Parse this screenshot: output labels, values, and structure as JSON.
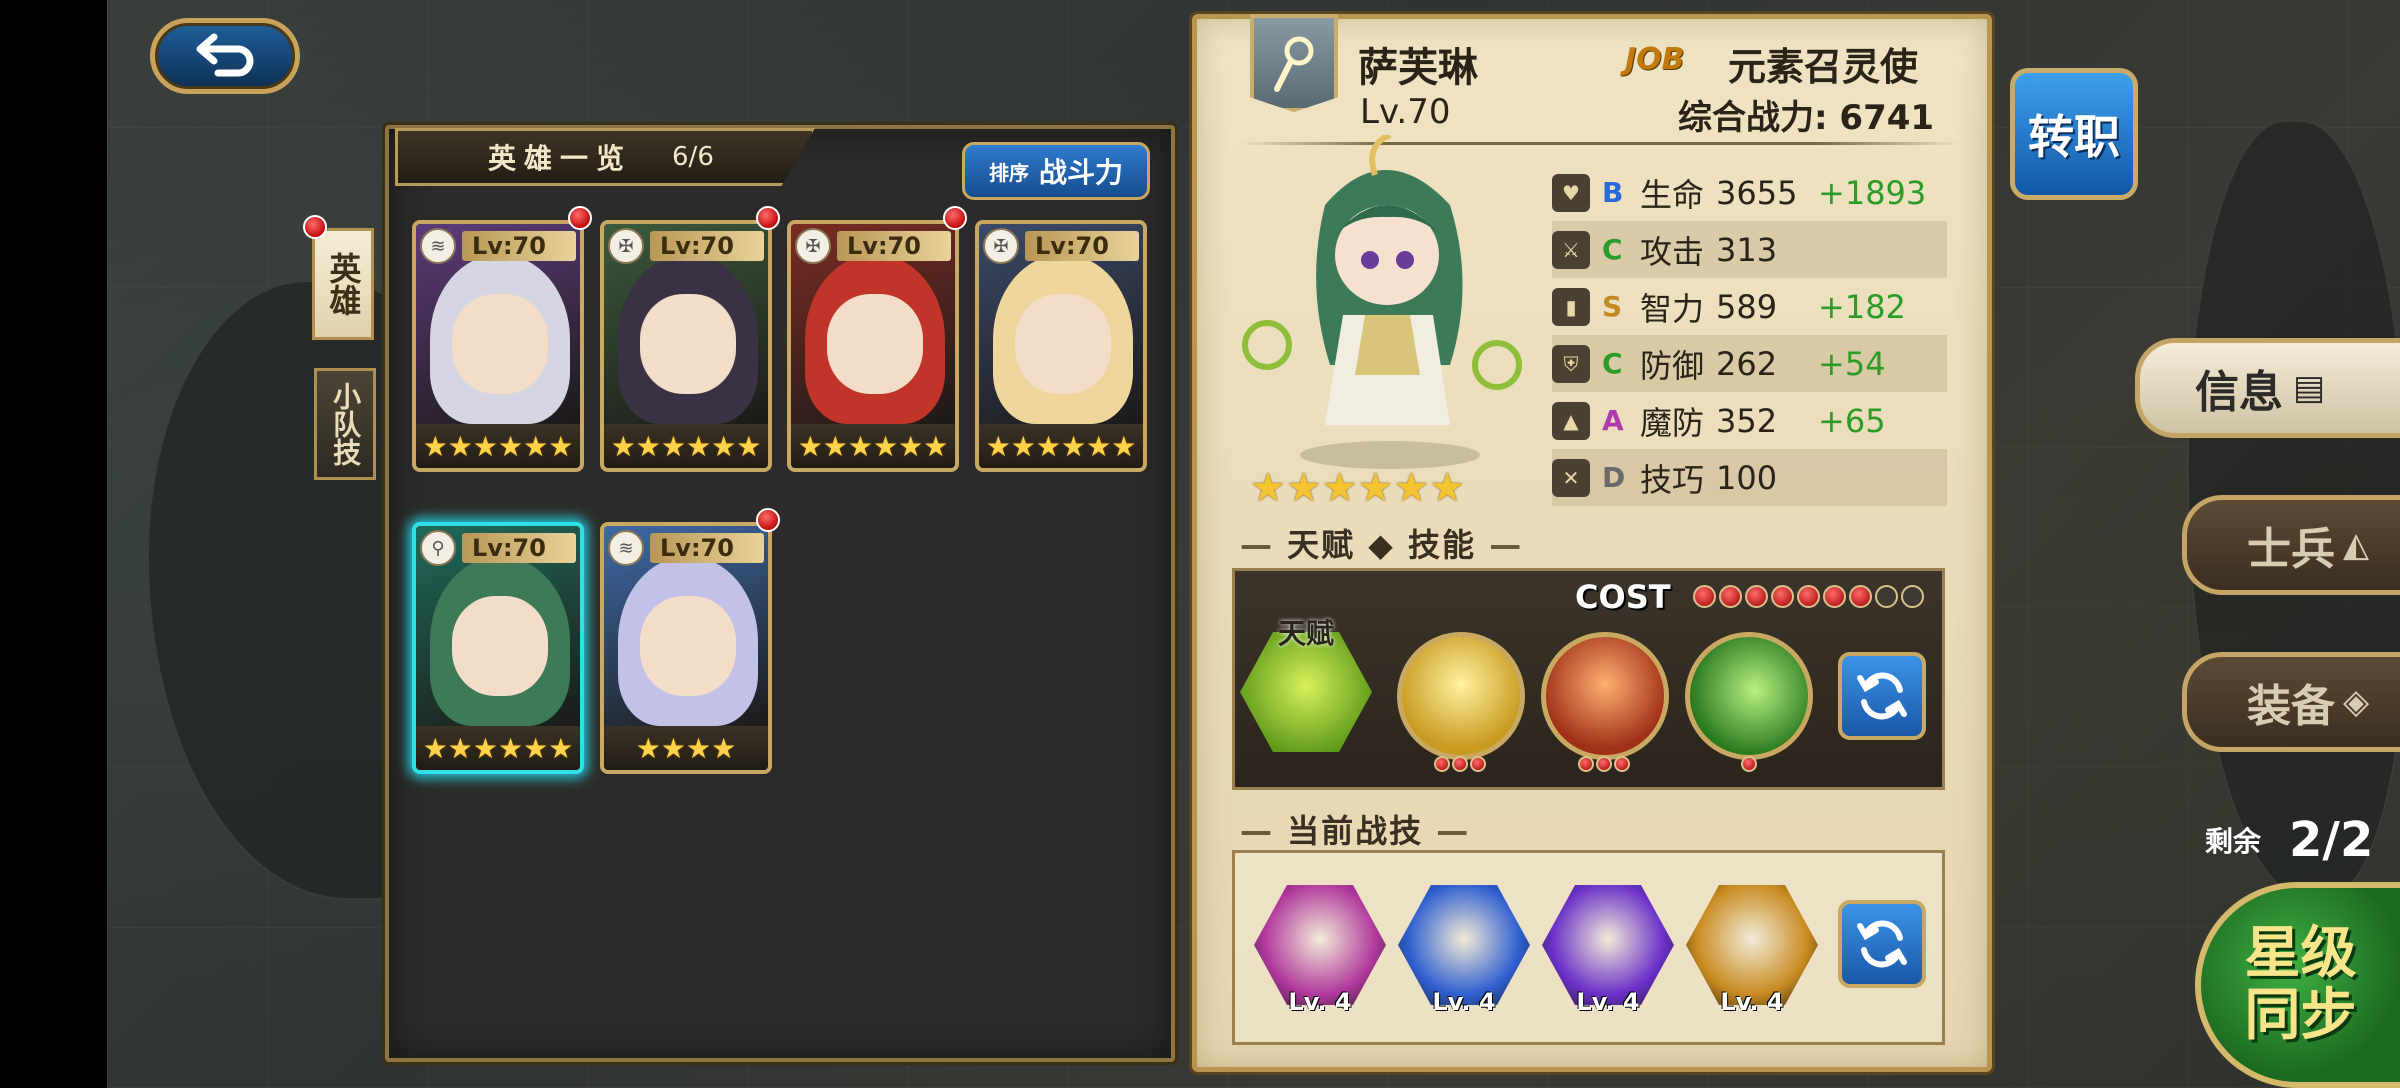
{
  "hero_list": {
    "title": "英雄一览",
    "count": "6/6",
    "sort_prefix": "排序",
    "sort_value": "战斗力",
    "tabs": [
      {
        "label": "英雄"
      },
      {
        "label": "小队技"
      }
    ],
    "cards": [
      {
        "level": "Lv:70",
        "stars": "★★★★★★",
        "class_icon": "wave-icon",
        "new": true,
        "hair": "#d6d6e2",
        "bg": "#5d3b7a"
      },
      {
        "level": "Lv:70",
        "stars": "★★★★★★",
        "class_icon": "cross-icon",
        "new": true,
        "hair": "#3a3244",
        "bg": "#3c5a3c"
      },
      {
        "level": "Lv:70",
        "stars": "★★★★★★",
        "class_icon": "cross-icon",
        "new": true,
        "hair": "#c0342a",
        "bg": "#7a2c24"
      },
      {
        "level": "Lv:70",
        "stars": "★★★★★★",
        "class_icon": "cross-icon",
        "new": false,
        "hair": "#efd69a",
        "bg": "#3a4a6a"
      },
      {
        "level": "Lv:70",
        "stars": "★★★★★★",
        "class_icon": "staff-icon",
        "new": false,
        "hair": "#3c7a58",
        "bg": "#1f6a5a",
        "selected": true
      },
      {
        "level": "Lv:70",
        "stars": "★★★★",
        "class_icon": "wave-icon",
        "new": true,
        "hair": "#c2c2e8",
        "bg": "#3e6aa8"
      }
    ]
  },
  "hero_detail": {
    "name": "萨芙琳",
    "level": "Lv.70",
    "job_tag": "JOB",
    "job_name": "元素召灵使",
    "power": "综合战力: 6741",
    "stars": "★★★★★★",
    "stats": [
      {
        "icon": "heart-icon",
        "grade": "B",
        "label": "生命",
        "value": "3655",
        "bonus": "+1893"
      },
      {
        "icon": "sword-icon",
        "grade": "C",
        "label": "攻击",
        "value": "313",
        "bonus": ""
      },
      {
        "icon": "book-icon",
        "grade": "S",
        "label": "智力",
        "value": "589",
        "bonus": "+182"
      },
      {
        "icon": "shield-icon",
        "grade": "C",
        "label": "防御",
        "value": "262",
        "bonus": "+54"
      },
      {
        "icon": "hat-icon",
        "grade": "A",
        "label": "魔防",
        "value": "352",
        "bonus": "+65"
      },
      {
        "icon": "bow-icon",
        "grade": "D",
        "label": "技巧",
        "value": "100",
        "bonus": ""
      }
    ],
    "talent_section": "天赋 ◆ 技能",
    "cost_label": "COST",
    "cost_filled": 7,
    "cost_total": 9,
    "talent_label": "天赋",
    "battle_section": "当前战技",
    "battle_skills": [
      {
        "level": "Lv. 4",
        "color": "#b0389c"
      },
      {
        "level": "Lv. 4",
        "color": "#2f5fd0"
      },
      {
        "level": "Lv. 4",
        "color": "#6a30c8"
      },
      {
        "level": "Lv. 4",
        "color": "#c88a20"
      }
    ]
  },
  "side_buttons": {
    "job_change": "转职",
    "info": "信息",
    "soldier": "士兵",
    "equip": "装备",
    "remain_label": "剩余",
    "remain_value": "2/2",
    "star_sync_line1": "星级",
    "star_sync_line2": "同步"
  },
  "colors": {
    "accent_gold": "#c8a863",
    "bonus_green": "#2c9b28",
    "button_blue": "#1a58a8",
    "selected_cyan": "#2fe0e6"
  }
}
